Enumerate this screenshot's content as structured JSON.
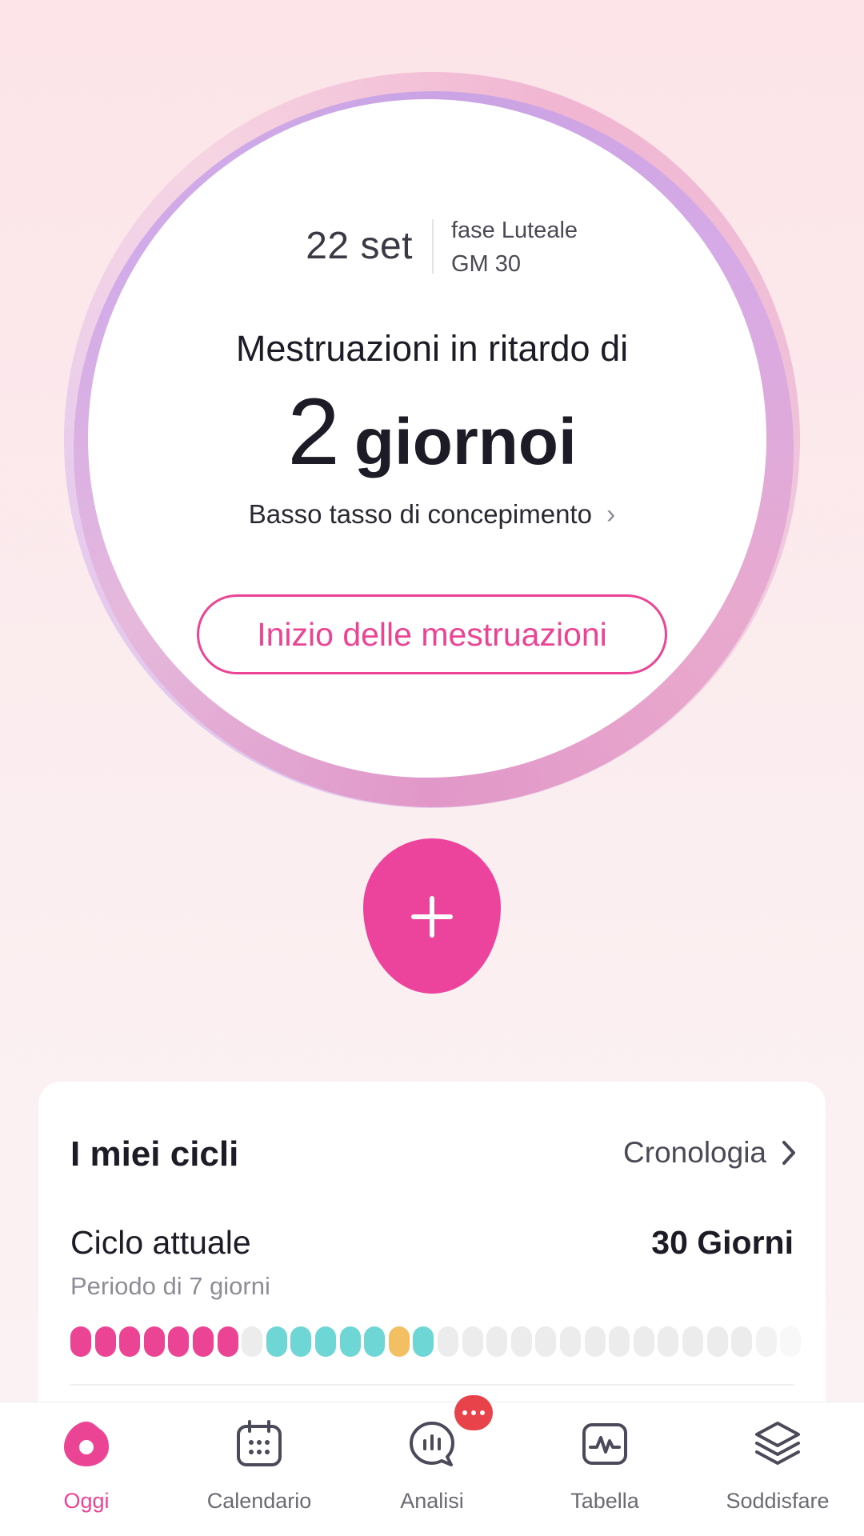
{
  "today": {
    "date": "22 set",
    "phase": "fase Luteale",
    "cycle_day": "GM 30",
    "delay_title": "Mestruazioni in ritardo di",
    "delay_number": "2",
    "delay_unit": "giornoi",
    "conception_text": "Basso tasso di concepimento",
    "start_period_label": "Inizio delle mestruazioni"
  },
  "cycles": {
    "title": "I miei cicli",
    "history_label": "Cronologia",
    "current_cycle_label": "Ciclo attuale",
    "current_cycle_days": "30 Giorni",
    "period_note": "Periodo di 7 giorni",
    "day_states": [
      "period",
      "period",
      "period",
      "period",
      "period",
      "period",
      "period",
      "empty",
      "fertile",
      "fertile",
      "fertile",
      "fertile",
      "fertile",
      "ovulation",
      "fertile",
      "empty",
      "empty",
      "empty",
      "empty",
      "empty",
      "empty",
      "empty",
      "empty",
      "empty",
      "empty",
      "empty",
      "empty",
      "empty",
      "empty",
      "empty"
    ],
    "state_colors": {
      "period": "#ec4494",
      "fertile": "#6fd6d6",
      "ovulation": "#f2c063",
      "empty": "#ececec"
    }
  },
  "nav": {
    "items": [
      {
        "label": "Oggi",
        "icon": "today-icon",
        "active": true
      },
      {
        "label": "Calendario",
        "icon": "calendar-icon",
        "active": false
      },
      {
        "label": "Analisi",
        "icon": "analysis-icon",
        "active": false
      },
      {
        "label": "Tabella",
        "icon": "chart-icon",
        "active": false
      },
      {
        "label": "Soddisfare",
        "icon": "layers-icon",
        "active": false
      }
    ]
  },
  "colors": {
    "accent": "#ec4494",
    "badge": "#e8424b"
  }
}
